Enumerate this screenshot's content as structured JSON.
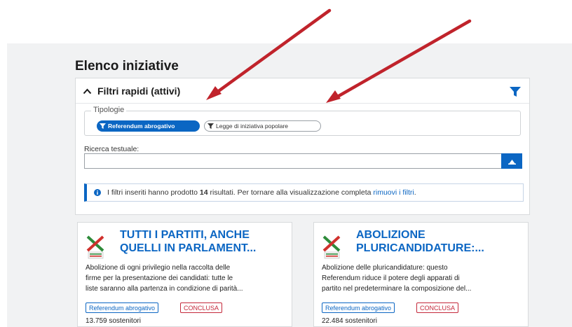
{
  "page": {
    "title": "Elenco iniziative"
  },
  "filters": {
    "header": "Filtri rapidi (attivi)",
    "legend": "Tipologie",
    "chips": [
      {
        "label": "Referendum abrogativo",
        "active": true
      },
      {
        "label": "Legge di iniziativa popolare",
        "active": false
      }
    ],
    "search_label": "Ricerca testuale:",
    "search_value": "",
    "info": {
      "prefix": "I filtri inseriti hanno prodotto",
      "count": "14",
      "middle": "risultati. Per tornare alla visualizzazione completa",
      "link": "rimuovi i filtri",
      "suffix": "."
    }
  },
  "cards": [
    {
      "title": "TUTTI I PARTITI, ANCHE QUELLI IN PARLAMENT...",
      "title_line1": "TUTTI I PARTITI, ANCHE",
      "title_line2": "QUELLI IN PARLAMENT...",
      "desc_lines": [
        "Abolizione di ogni privilegio nella raccolta delle",
        "firme per la presentazione dei candidati: tutte le",
        "liste saranno alla partenza in condizione di parità..."
      ],
      "type_badge": "Referendum abrogativo",
      "status_badge": "CONCLUSA",
      "supporters": "13.759 sostenitori"
    },
    {
      "title": "ABOLIZIONE PLURICANDIDATURE:...",
      "title_line1": "ABOLIZIONE",
      "title_line2": "PLURICANDIDATURE:...",
      "desc_lines": [
        "Abolizione delle pluricandidature: questo",
        "Referendum riduce il potere degli apparati di",
        "partito nel predeterminare la composizione del..."
      ],
      "type_badge": "Referendum abrogativo",
      "status_badge": "CONCLUSA",
      "supporters": "22.484 sostenitori"
    }
  ],
  "colors": {
    "accent": "#0b66c3",
    "status_red": "#c4283a",
    "annotation_arrow": "#c0232b"
  },
  "icons": [
    "chevron-up-icon",
    "filter-icon",
    "search-icon",
    "info-icon",
    "logo-icon"
  ]
}
